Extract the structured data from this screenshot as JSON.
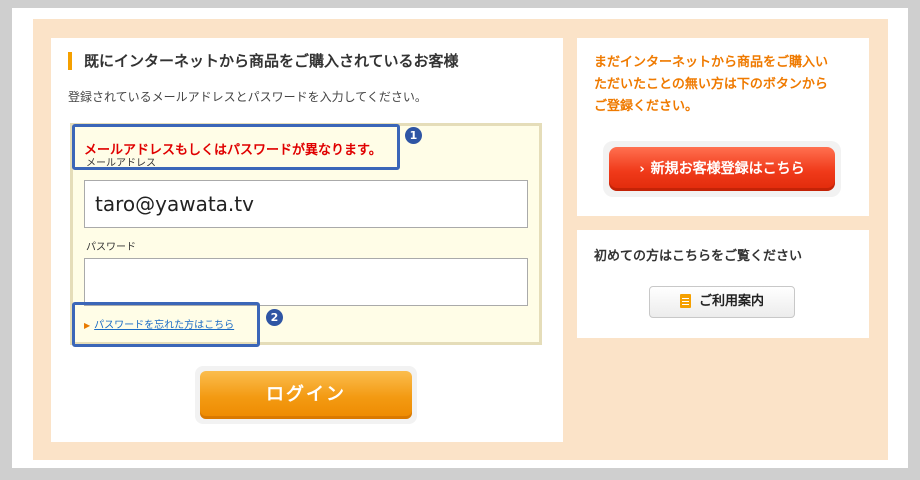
{
  "login_panel": {
    "heading": "既にインターネットから商品をご購入されているお客様",
    "instruction": "登録されているメールアドレスとパスワードを入力してください。",
    "error_message": "メールアドレスもしくはパスワードが異なります。",
    "email_label": "メールアドレス",
    "email_value": "taro@yawata.tv",
    "password_label": "パスワード",
    "password_value": "",
    "forgot_link": "パスワードを忘れた方はこちら",
    "login_button": "ログイン"
  },
  "annotations": {
    "badge1": "1",
    "badge2": "2"
  },
  "register_panel": {
    "line1": "まだインターネットから商品をご購入い",
    "line2": "ただいたことの無い方は下のボタンから",
    "line3": "ご登録ください。",
    "button_label": "新規お客様登録はこちら",
    "button_icon": "chevron-right-icon"
  },
  "guide_panel": {
    "heading": "初めての方はこちらをご覧ください",
    "button_label": "ご利用案内",
    "button_icon": "document-icon"
  },
  "colors": {
    "accent_orange": "#f39a12",
    "error_red": "#e00000",
    "register_red": "#f03a1a",
    "annotation_blue": "#3b66b8",
    "link_blue": "#1a6bc4"
  }
}
